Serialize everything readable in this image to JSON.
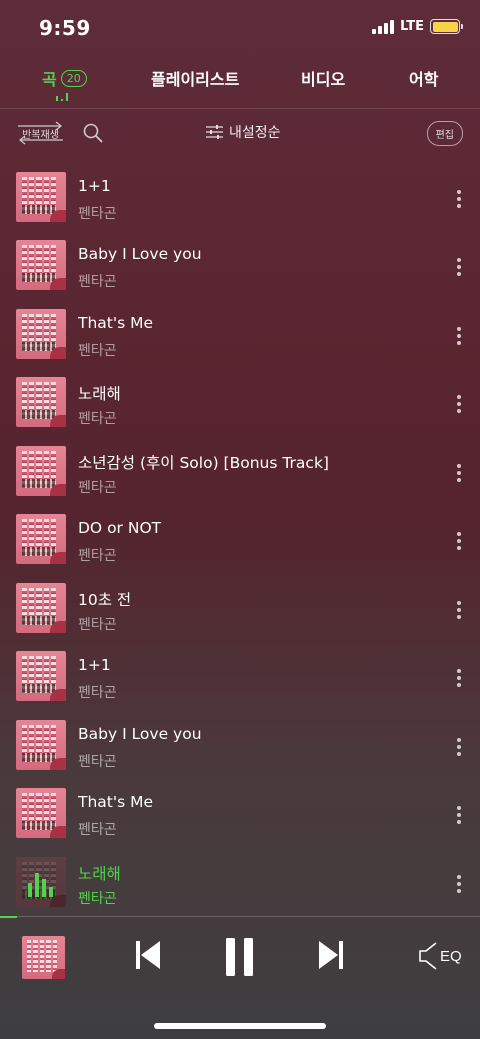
{
  "status_bar": {
    "time": "9:59",
    "network": "LTE",
    "signal_bars": 4,
    "battery_color": "#f7d548"
  },
  "tabs": {
    "songs": {
      "label": "곡",
      "count": "20",
      "active": true
    },
    "playlist": {
      "label": "플레이리스트"
    },
    "video": {
      "label": "비디오"
    },
    "language": {
      "label": "어학"
    }
  },
  "toolbar": {
    "repeat_label": "반복재생",
    "sort_label": "내설정순",
    "edit_label": "편집"
  },
  "songs": [
    {
      "title": "1+1",
      "artist": "펜타곤"
    },
    {
      "title": "Baby I Love you",
      "artist": "펜타곤"
    },
    {
      "title": "That's Me",
      "artist": "펜타곤"
    },
    {
      "title": "노래해",
      "artist": "펜타곤"
    },
    {
      "title": "소년감성 (후이 Solo) [Bonus Track]",
      "artist": "펜타곤"
    },
    {
      "title": "DO or NOT",
      "artist": "펜타곤"
    },
    {
      "title": "10초 전",
      "artist": "펜타곤"
    },
    {
      "title": "1+1",
      "artist": "펜타곤"
    },
    {
      "title": "Baby I Love you",
      "artist": "펜타곤"
    },
    {
      "title": "That's Me",
      "artist": "펜타곤"
    },
    {
      "title": "노래해",
      "artist": "펜타곤",
      "now_playing": true
    }
  ],
  "player": {
    "eq_label": "EQ",
    "progress_fraction": 0.035,
    "state": "playing"
  },
  "colors": {
    "accent": "#4fd44a",
    "album_pink": "#e58596"
  }
}
